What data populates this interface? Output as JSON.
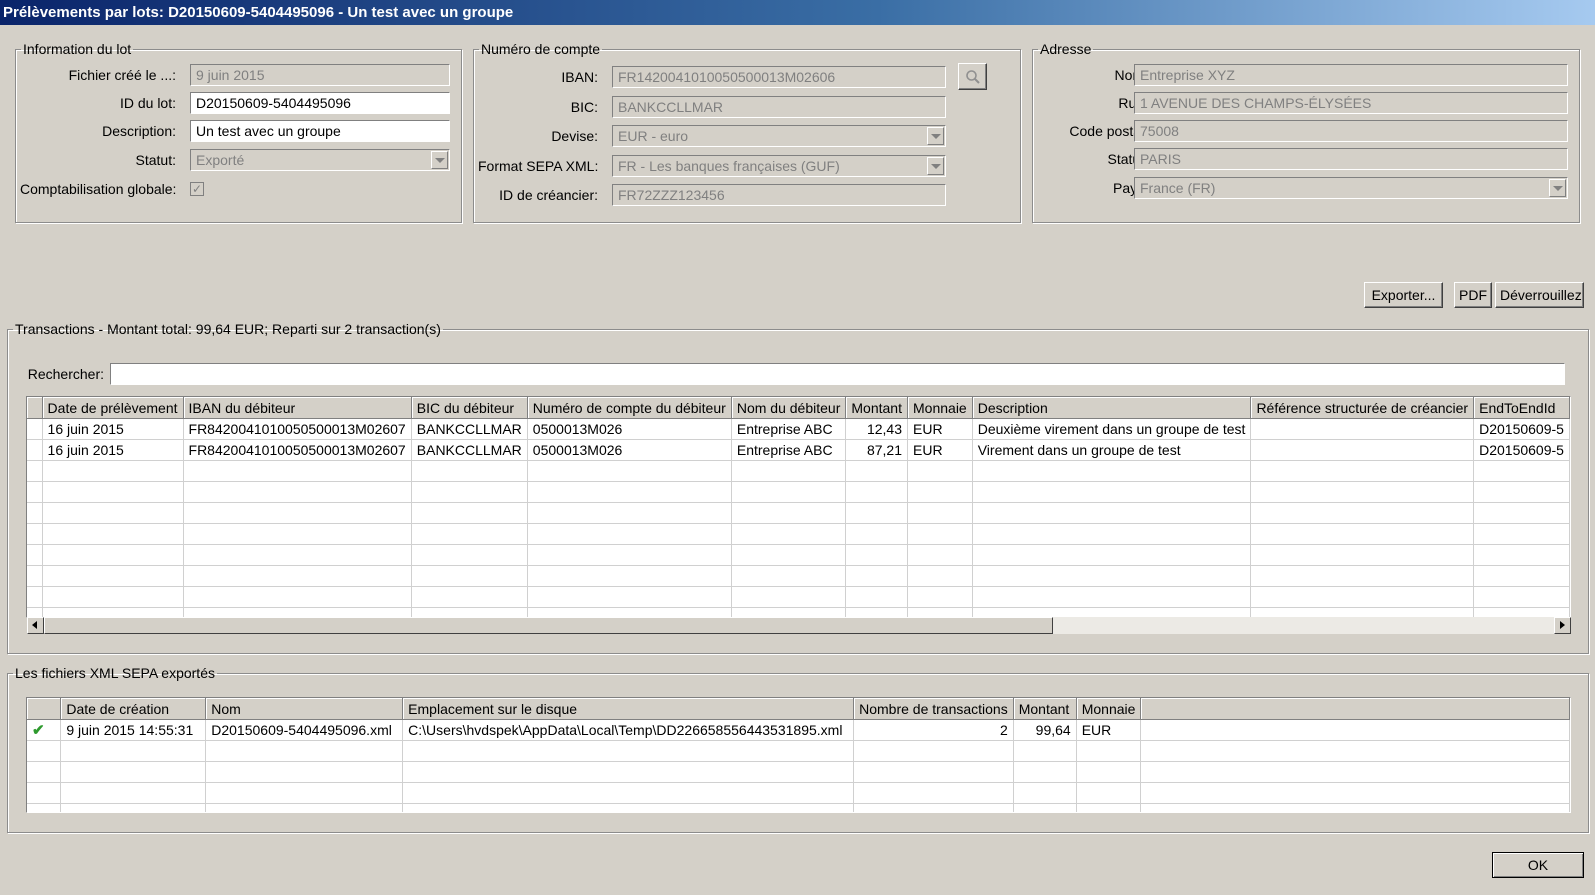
{
  "window": {
    "title": "Prélèvements par lots: D20150609-5404495096 - Un test avec un groupe"
  },
  "batch_info": {
    "legend": "Information du lot",
    "created_label": "Fichier créé le ...:",
    "created_value": "9 juin 2015",
    "id_label": "ID du lot:",
    "id_value": "D20150609-5404495096",
    "description_label": "Description:",
    "description_value": "Un test avec un groupe",
    "status_label": "Statut:",
    "status_value": "Exporté",
    "global_label": "Comptabilisation globale:",
    "global_checked": true
  },
  "account": {
    "legend": "Numéro de compte",
    "iban_label": "IBAN:",
    "iban_value": "FR1420041010050500013M02606",
    "bic_label": "BIC:",
    "bic_value": "BANKCCLLMAR",
    "currency_label": "Devise:",
    "currency_value": "EUR - euro",
    "sepa_label": "Format SEPA XML:",
    "sepa_value": "FR - Les banques françaises (GUF)",
    "creditor_label": "ID de créancier:",
    "creditor_value": "FR72ZZZ123456",
    "search_icon": "magnifier-icon"
  },
  "address": {
    "legend": "Adresse",
    "name_label": "Nom:",
    "name_value": "Entreprise XYZ",
    "street_label": "Rue:",
    "street_value": "1 AVENUE DES CHAMPS-ÉLYSÉES",
    "postal_label": "Code postal:",
    "postal_value": "75008",
    "city_label": "Statut:",
    "city_value": "PARIS",
    "country_label": "Pays:",
    "country_value": "France (FR)"
  },
  "toolbar": {
    "export_label": "Exporter...",
    "pdf_label": "PDF",
    "unlock_label": "Déverrouillez"
  },
  "transactions": {
    "legend": "Transactions - Montant total: 99,64 EUR; Reparti sur 2 transaction(s)",
    "search_label": "Rechercher:",
    "search_value": "",
    "columns": [
      "",
      "Date de prélèvement",
      "IBAN du débiteur",
      "BIC du débiteur",
      "Numéro de compte du débiteur",
      "Nom du débiteur",
      "Montant",
      "Monnaie",
      "Description",
      "Référence structurée de créancier",
      "EndToEndId"
    ],
    "rows": [
      [
        "",
        "16 juin 2015",
        "FR8420041010050500013M02607",
        "BANKCCLLMAR",
        "0500013M026",
        "Entreprise ABC",
        "12,43",
        "EUR",
        "Deuxième virement dans un groupe de test",
        "",
        "D20150609-5"
      ],
      [
        "",
        "16 juin 2015",
        "FR8420041010050500013M02607",
        "BANKCCLLMAR",
        "0500013M026",
        "Entreprise ABC",
        "87,21",
        "EUR",
        "Virement dans un groupe de test",
        "",
        "D20150609-5"
      ]
    ]
  },
  "exports": {
    "legend": "Les fichiers XML SEPA exportés",
    "columns": [
      "",
      "Date de création",
      "Nom",
      "Emplacement sur le disque",
      "Nombre de transactions",
      "Montant",
      "Monnaie",
      ""
    ],
    "rows": [
      [
        "check-icon",
        "9 juin 2015 14:55:31",
        "D20150609-5404495096.xml",
        "C:\\Users\\hvdspek\\AppData\\Local\\Temp\\DD226658556443531895.xml",
        "2",
        "99,64",
        "EUR",
        ""
      ]
    ]
  },
  "footer": {
    "ok_label": "OK"
  },
  "colors": {
    "title_start": "#0a246a",
    "title_end": "#a6caf0",
    "window_bg": "#d4d0c8",
    "check": "#2e9a2e"
  }
}
